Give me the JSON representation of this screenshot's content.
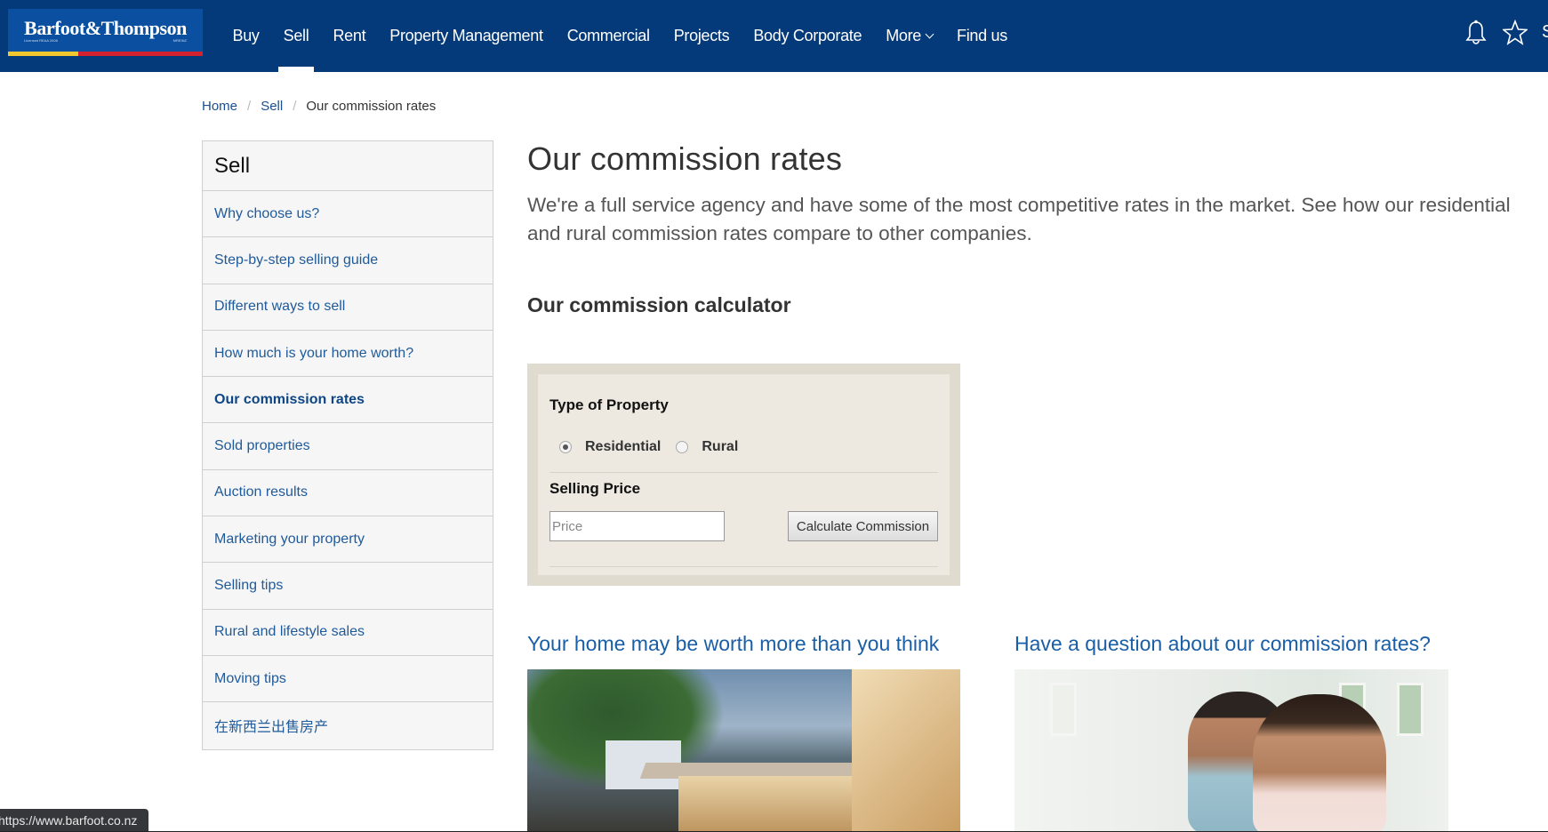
{
  "header": {
    "logo": {
      "name": "Barfoot&Thompson",
      "sub_left": "Licensed REAA 2008",
      "sub_right": "MREINZ"
    },
    "nav": [
      {
        "label": "Buy",
        "active": false
      },
      {
        "label": "Sell",
        "active": true
      },
      {
        "label": "Rent",
        "active": false
      },
      {
        "label": "Property Management",
        "active": false
      },
      {
        "label": "Commercial",
        "active": false
      },
      {
        "label": "Projects",
        "active": false
      },
      {
        "label": "Body Corporate",
        "active": false
      },
      {
        "label": "More",
        "active": false,
        "has_dropdown": true
      },
      {
        "label": "Find us",
        "active": false
      }
    ],
    "icons": [
      "bell-icon",
      "star-icon"
    ],
    "cut_off_text": "S",
    "colors": {
      "background": "#043a79",
      "logo_bg": "#0a4fa0",
      "stripe_yellow": "#f0c72c",
      "stripe_red": "#d4212f"
    }
  },
  "breadcrumb": {
    "items": [
      "Home",
      "Sell"
    ],
    "current": "Our commission rates",
    "separator": "/"
  },
  "sidebar": {
    "title": "Sell",
    "items": [
      {
        "label": "Why choose us?",
        "active": false
      },
      {
        "label": "Step-by-step selling guide",
        "active": false
      },
      {
        "label": "Different ways to sell",
        "active": false
      },
      {
        "label": "How much is your home worth?",
        "active": false
      },
      {
        "label": "Our commission rates",
        "active": true
      },
      {
        "label": "Sold properties",
        "active": false
      },
      {
        "label": "Auction results",
        "active": false
      },
      {
        "label": "Marketing your property",
        "active": false
      },
      {
        "label": "Selling tips",
        "active": false
      },
      {
        "label": "Rural and lifestyle sales",
        "active": false
      },
      {
        "label": "Moving tips",
        "active": false
      },
      {
        "label": "在新西兰出售房产",
        "active": false
      }
    ]
  },
  "main": {
    "title": "Our commission rates",
    "intro": "We're a full service agency and have some of the most competitive rates in the market. See how our residential and rural commission rates compare to other companies.",
    "calculator_title": "Our commission calculator",
    "calculator": {
      "type_label": "Type of Property",
      "options": [
        {
          "label": "Residential",
          "checked": true
        },
        {
          "label": "Rural",
          "checked": false
        }
      ],
      "price_label": "Selling Price",
      "price_value": "",
      "price_placeholder": "Price",
      "button_label": "Calculate Commission"
    },
    "cards": [
      {
        "title": "Your home may be worth more than you think",
        "image": "house-exterior-dusk"
      },
      {
        "title": "Have a question about our commission rates?",
        "image": "couple-looking-at-documents"
      }
    ]
  },
  "status_bar": {
    "url": "https://www.barfoot.co.nz"
  }
}
